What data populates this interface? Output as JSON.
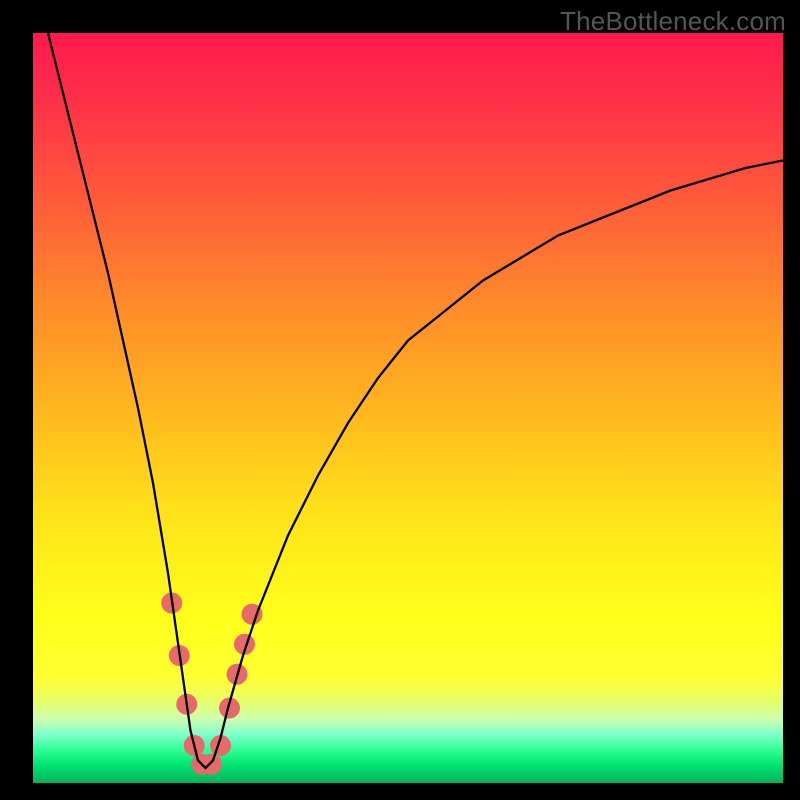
{
  "watermark": "TheBottleneck.com",
  "colors": {
    "frame": "#000000",
    "gradient_top": "#ff1a4d",
    "gradient_bottom": "#00b359",
    "curve": "#000000",
    "marker": "#e66a6a"
  },
  "chart_data": {
    "type": "line",
    "title": "",
    "xlabel": "",
    "ylabel": "",
    "xlim": [
      0,
      100
    ],
    "ylim": [
      0,
      100
    ],
    "series": [
      {
        "name": "bottleneck-curve",
        "x": [
          2,
          4,
          6,
          8,
          10,
          12,
          14,
          16,
          18,
          19,
          20,
          21,
          22,
          23,
          24,
          25,
          26,
          28,
          30,
          34,
          38,
          42,
          46,
          50,
          55,
          60,
          65,
          70,
          75,
          80,
          85,
          90,
          95,
          100
        ],
        "y": [
          100,
          92,
          84,
          76,
          68,
          59,
          50,
          40,
          28,
          21,
          14,
          7,
          3,
          2,
          3,
          6,
          10,
          17,
          23,
          33,
          41,
          48,
          54,
          59,
          63,
          67,
          70,
          73,
          75,
          77,
          79,
          80.5,
          82,
          83
        ]
      }
    ],
    "markers": {
      "name": "highlight-v",
      "points": [
        [
          18.5,
          24
        ],
        [
          19.5,
          17
        ],
        [
          20.5,
          10.5
        ],
        [
          21.5,
          5
        ],
        [
          22.5,
          2.5
        ],
        [
          23.8,
          2.5
        ],
        [
          25,
          5
        ],
        [
          26.2,
          10
        ],
        [
          27.2,
          14.5
        ],
        [
          28.2,
          18.5
        ],
        [
          29.2,
          22.5
        ]
      ],
      "radius_pct": 1.4
    }
  }
}
